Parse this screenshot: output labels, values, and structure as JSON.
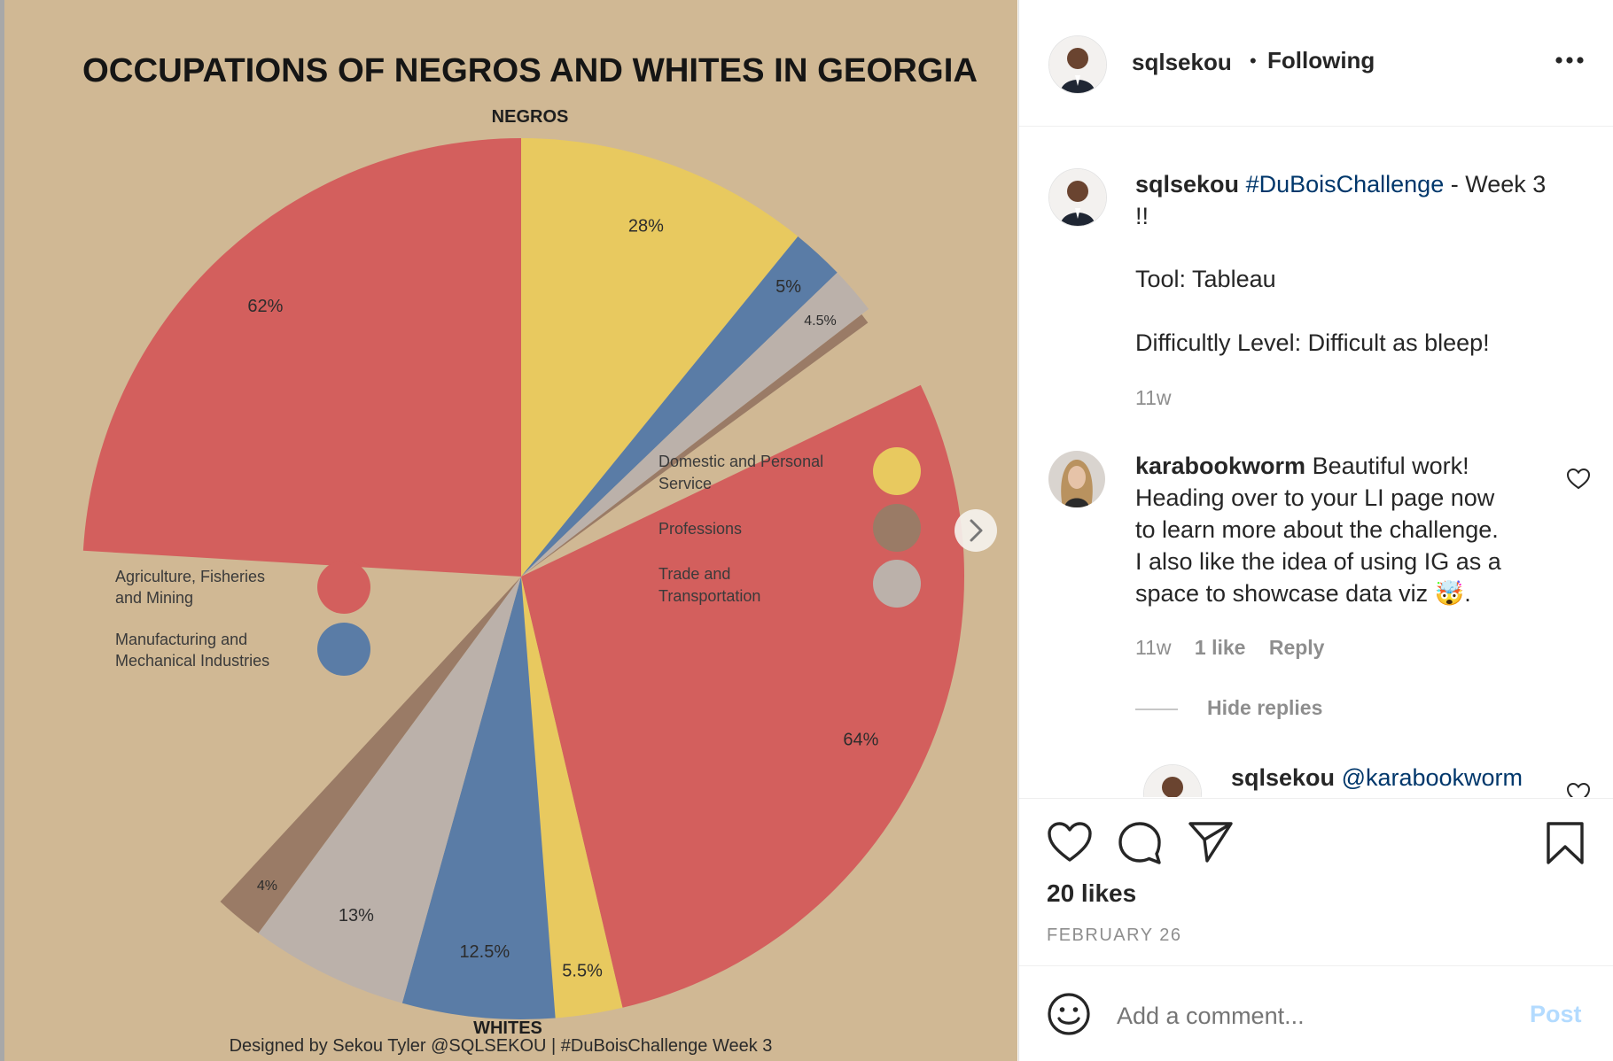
{
  "post": {
    "username": "sqlsekou",
    "separator": "•",
    "follow_status": "Following",
    "caption": {
      "username": "sqlsekou",
      "hashtag": "#DuBoisChallenge",
      "line1_rest": " - Week 3",
      "line2": "!!",
      "tool_line": "Tool: Tableau",
      "difficulty_line": "Difficultly Level: Difficult as bleep!",
      "time": "11w"
    },
    "comments": [
      {
        "username": "karabookworm",
        "lines": [
          " Beautiful work!",
          "Heading over to your LI page now",
          "to learn more about the challenge.",
          "I also like the idea of using IG as a",
          "space to showcase data viz 🤯."
        ],
        "time": "11w",
        "likes": "1 like",
        "reply_label": "Reply",
        "hide_replies_label": "Hide replies"
      }
    ],
    "reply_preview": {
      "username": "sqlsekou",
      "mention": "@karabookworm"
    },
    "likes": "20 likes",
    "date": "FEBRUARY 26",
    "comment_input": {
      "placeholder": "Add a comment...",
      "post_label": "Post"
    },
    "icons": {
      "more": "more-options-icon",
      "like": "heart-icon",
      "comment": "comment-bubble-icon",
      "share": "paper-plane-icon",
      "save": "bookmark-icon",
      "emoji": "emoji-smiley-icon",
      "next": "chevron-right-icon"
    }
  },
  "chart_data": {
    "type": "pie",
    "title": "OCCUPATIONS OF NEGROS AND WHITES IN GEORGIA",
    "credit": "Designed by Sekou Tyler @SQLSEKOU | #DuBoisChallenge Week 3",
    "groups": [
      {
        "name": "NEGROS",
        "slices": [
          {
            "category": "Agriculture, Fisheries and Mining",
            "value": 62,
            "label": "62%"
          },
          {
            "category": "Domestic and Personal Service",
            "value": 28,
            "label": "28%"
          },
          {
            "category": "Manufacturing and Mechanical Industries",
            "value": 5,
            "label": "5%"
          },
          {
            "category": "Trade and Transportation",
            "value": 4.5,
            "label": "4.5%"
          },
          {
            "category": "Professions",
            "value": 1,
            "label": ""
          }
        ]
      },
      {
        "name": "WHITES",
        "slices": [
          {
            "category": "Agriculture, Fisheries and Mining",
            "value": 64,
            "label": "64%"
          },
          {
            "category": "Domestic and Personal Service",
            "value": 5.5,
            "label": "5.5%"
          },
          {
            "category": "Manufacturing and Mechanical Industries",
            "value": 12.5,
            "label": "12.5%"
          },
          {
            "category": "Trade and Transportation",
            "value": 13,
            "label": "13%"
          },
          {
            "category": "Professions",
            "value": 4,
            "label": "4%"
          }
        ]
      }
    ],
    "legend": [
      {
        "label": "Domestic and Personal Service",
        "color": "#e8c95f"
      },
      {
        "label": "Professions",
        "color": "#9a7b66"
      },
      {
        "label": "Trade and Transportation",
        "color": "#bbb1aa"
      },
      {
        "label": "Agriculture, Fisheries and Mining",
        "color": "#d35f5d"
      },
      {
        "label": "Manufacturing and Mechanical Industries",
        "color": "#5a7ca6"
      }
    ],
    "colors": {
      "Agriculture, Fisheries and Mining": "#d35f5d",
      "Domestic and Personal Service": "#e8c95f",
      "Manufacturing and Mechanical Industries": "#5a7ca6",
      "Trade and Transportation": "#bbb1aa",
      "Professions": "#9a7b66"
    },
    "background": "#d0b894"
  }
}
